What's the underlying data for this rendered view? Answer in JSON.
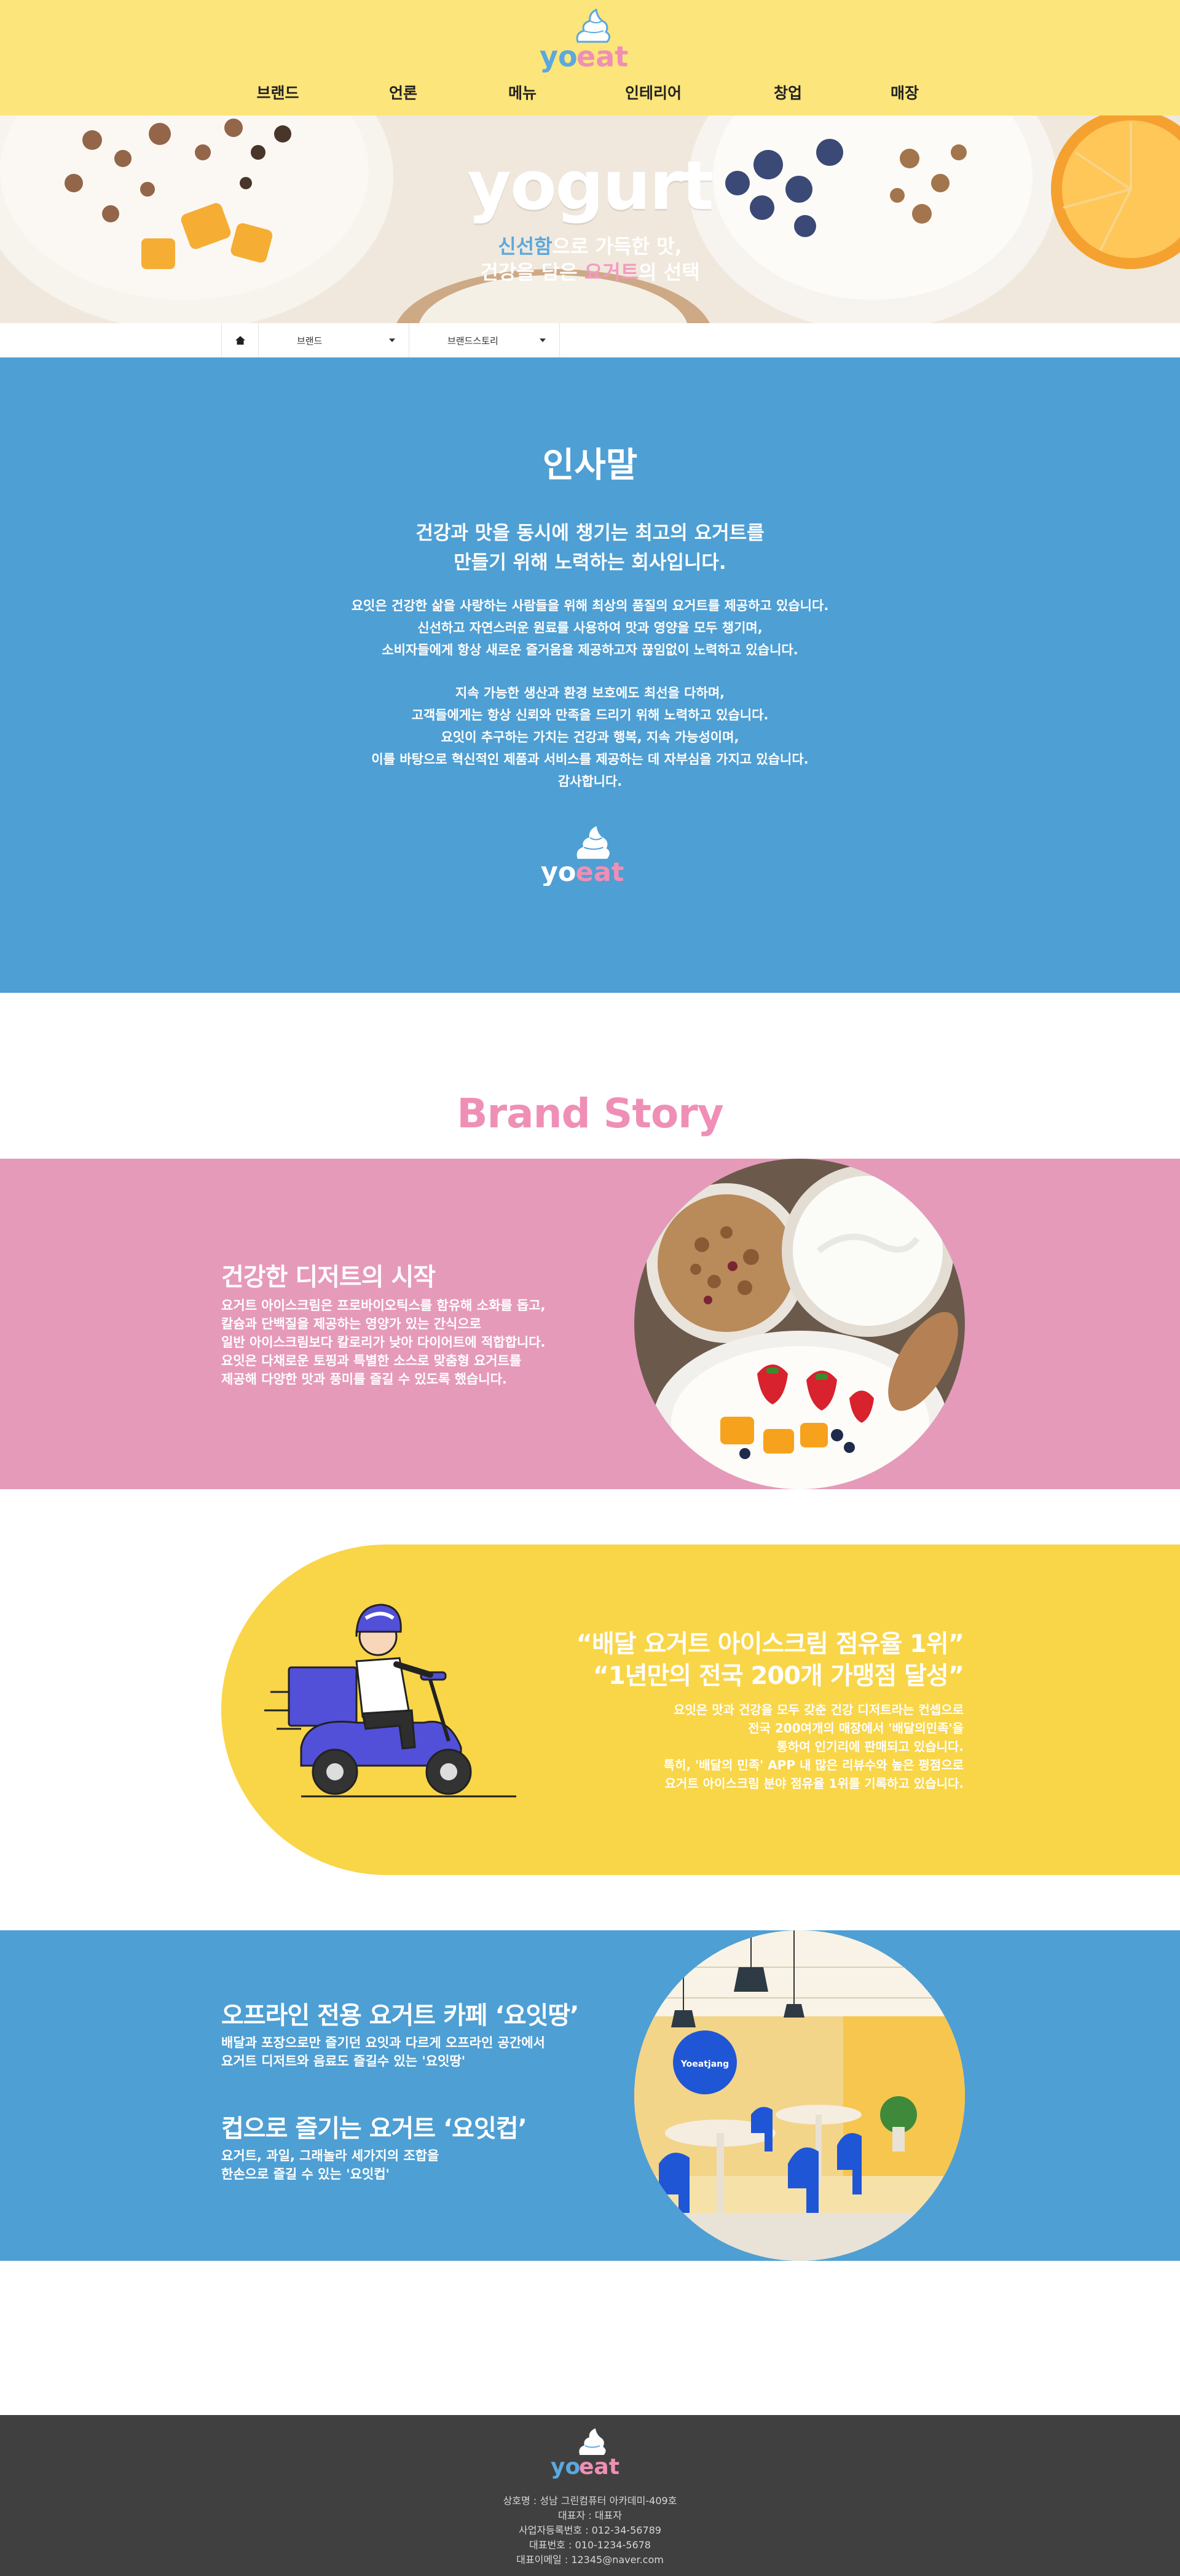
{
  "brand": {
    "logo_text_a": "yo",
    "logo_text_b": "eat"
  },
  "nav": {
    "items": [
      {
        "label": "브랜드"
      },
      {
        "label": "언론"
      },
      {
        "label": "메뉴"
      },
      {
        "label": "인테리어"
      },
      {
        "label": "창업"
      },
      {
        "label": "매장"
      }
    ]
  },
  "hero": {
    "word": "yogurt",
    "sub_line1_hl": "신선함",
    "sub_line1_rest": "으로 가득한 맛,",
    "sub_line2_pre": "건강을 담은 ",
    "sub_line2_hl": "요거트",
    "sub_line2_post": "의 선택"
  },
  "breadcrumb": {
    "first": "브랜드",
    "second": "브랜드스토리"
  },
  "greeting": {
    "title": "인사말",
    "lead_line1": "건강과 맛을 동시에 챙기는 최고의 요거트를",
    "lead_line2": "만들기 위해 노력하는 회사입니다.",
    "p1_line1": "요잇은 건강한 삶을 사랑하는 사람들을 위해 최상의 품질의 요거트를 제공하고 있습니다.",
    "p1_line2": "신선하고 자연스러운 원료를 사용하여 맛과 영양을 모두 챙기며,",
    "p1_line3": "소비자들에게 항상 새로운 즐거움을 제공하고자 끊임없이 노력하고 있습니다.",
    "p2_line1": "지속 가능한 생산과 환경 보호에도 최선을 다하며,",
    "p2_line2": "고객들에게는 항상 신뢰와 만족을 드리기 위해 노력하고 있습니다.",
    "p2_line3": "요잇이 추구하는 가치는 건강과 행복, 지속 가능성이며,",
    "p2_line4": "이를 바탕으로 혁신적인 제품과 서비스를 제공하는 데 자부심을 가지고 있습니다.",
    "p2_line5": "감사합니다."
  },
  "story": {
    "title": "Brand Story",
    "block1": {
      "title": "건강한 디저트의 시작",
      "line1": "요거트 아이스크림은 프로바이오틱스를 함유해 소화를 돕고,",
      "line2": "칼슘과 단백질을 제공하는 영양가 있는 간식으로",
      "line3": "일반 아이스크림보다 칼로리가 낮아 다이어트에 적합합니다.",
      "line4": "요잇은 다채로운 토핑과 특별한 소스로 맞춤형 요거트를",
      "line5": "제공해 다양한 맛과 풍미를 즐길 수 있도록 했습니다."
    },
    "block2": {
      "quote1": "“배달 요거트 아이스크림 점유율 1위”",
      "quote2": "“1년만의 전국 200개 가맹점 달성”",
      "line1": "요잇은 맛과 건강을 모두 갖춘 건강 디저트라는 컨셉으로",
      "line2": "전국 200여개의 매장에서 '배달의민족'을",
      "line3": "통하여 인기리에 판매되고 있습니다.",
      "line4": "특히, '배달의 민족' APP 내 많은 리뷰수와 높은 평점으로",
      "line5": "요거트 아이스크림 분야 점유율 1위를 기록하고 있습니다."
    },
    "block3": {
      "title1": "오프라인 전용 요거트 카페 ‘요잇땅’",
      "line1": "배달과 포장으로만 즐기던 요잇과 다르게 오프라인 공간에서",
      "line2": "요거트 디저트와 음료도 즐길수 있는 '요잇땅'",
      "title2": "컵으로 즐기는 요거트 ‘요잇컵’",
      "line3": "요거트, 과일, 그래놀라 세가지의 조합을",
      "line4": "한손으로 즐길 수 있는 '요잇컵'",
      "sign": "Yoeatjang"
    }
  },
  "footer": {
    "line1": "상호명 : 성남 그린컴퓨터 아카데미-409호",
    "line2": "대표자 : 대표자",
    "line3": "사업자등록번호 : 012-34-56789",
    "line4": "대표번호 : 010-1234-5678",
    "line5": "대표이메일 : 12345@naver.com"
  },
  "colors": {
    "header_yellow": "#fce57a",
    "blue": "#4e9fd4",
    "pink": "#e69aba",
    "brand_pink": "#ef8fb6",
    "yellow": "#f9d548",
    "footer": "#404040"
  }
}
